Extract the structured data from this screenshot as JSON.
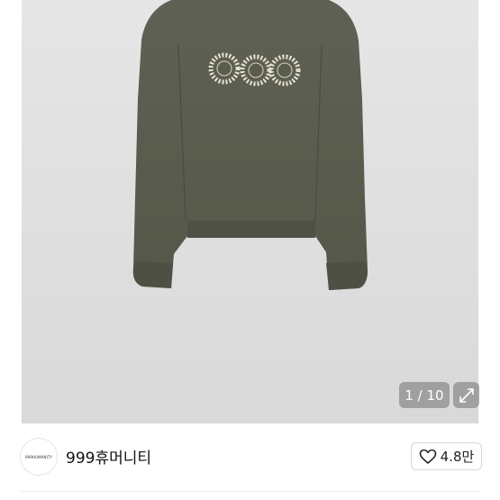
{
  "gallery": {
    "counter": "1 / 10",
    "expand_icon": "expand-icon",
    "image": "olive-green-knit-sweater-with-three-daisy-motifs"
  },
  "shop": {
    "avatar_text": "999HUMANITY",
    "name": "999휴머니티",
    "like_icon": "heart-outline-icon",
    "like_count": "4.8만"
  },
  "colors": {
    "sweater": "#5a5c4e",
    "background": "#e3e3e3",
    "overlay": "#8c8c8c"
  }
}
